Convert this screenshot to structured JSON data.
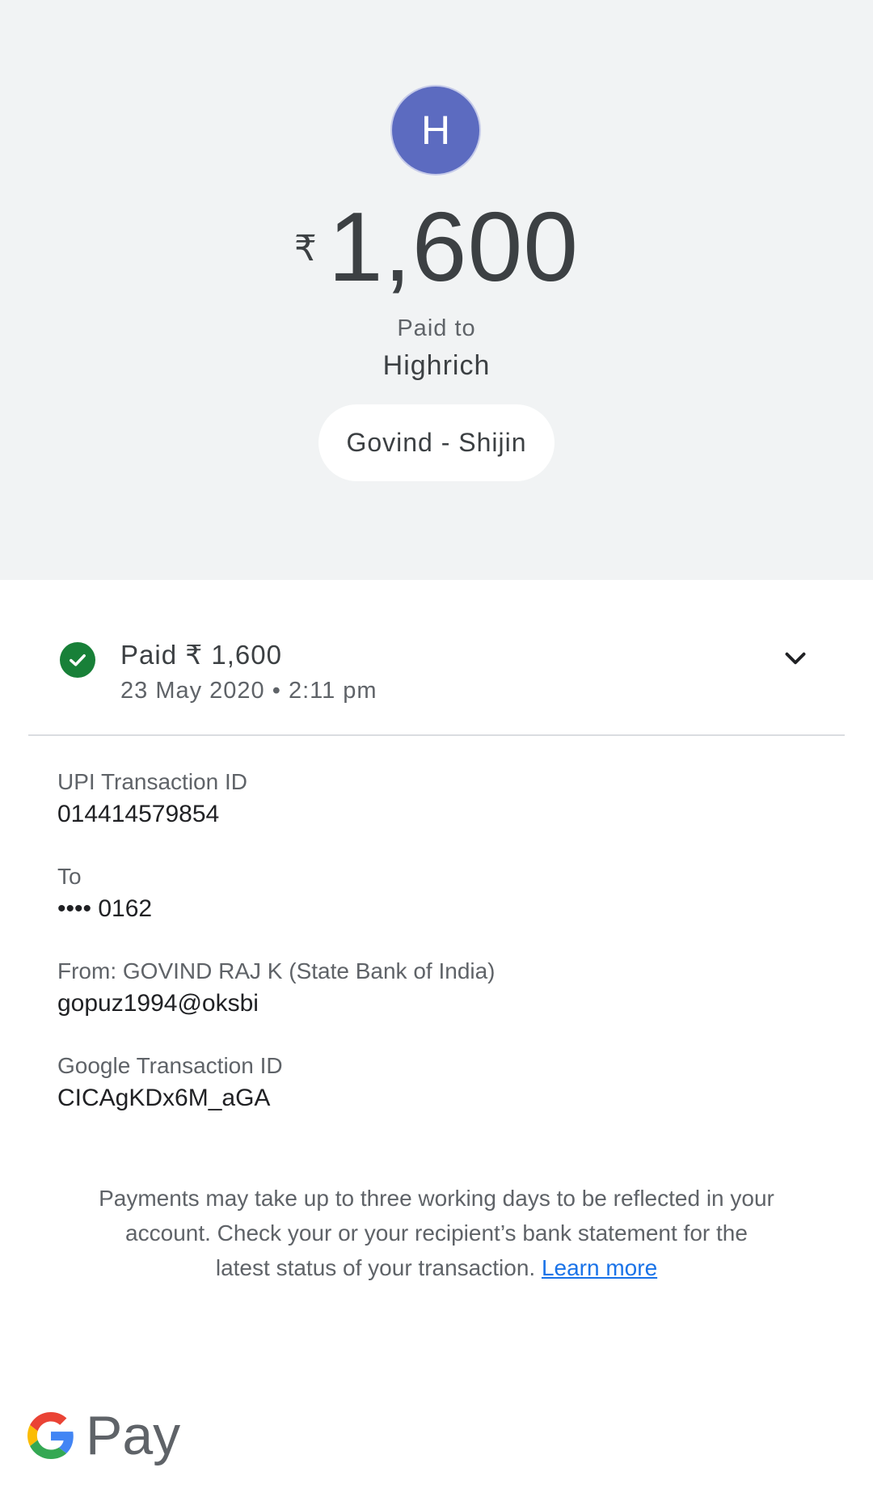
{
  "header": {
    "avatar_letter": "H",
    "currency_symbol": "₹",
    "amount": "1,600",
    "paid_to_label": "Paid to",
    "payee_name": "Highrich",
    "note": "Govind - Shijin"
  },
  "status": {
    "title": "Paid ₹ 1,600",
    "date": "23 May 2020 • 2:11 pm",
    "icon": "check-circle-icon",
    "expand_icon": "chevron-down-icon"
  },
  "details": [
    {
      "label": "UPI Transaction ID",
      "value": "014414579854"
    },
    {
      "label": "To",
      "value": "•••• 0162"
    },
    {
      "label": "From: GOVIND RAJ  K (State Bank of India)",
      "value": "gopuz1994@oksbi"
    },
    {
      "label": "Google Transaction ID",
      "value": "CICAgKDx6M_aGA"
    }
  ],
  "disclaimer": {
    "text": "Payments may take up to three working days to be reflected in your account. Check your or your recipient’s bank statement for the latest status of your transaction. ",
    "link_label": "Learn more"
  },
  "logo": {
    "brand_text": "Pay"
  },
  "colors": {
    "avatar": "#5c6bc0",
    "success": "#188038",
    "link": "#1a73e8",
    "header_bg": "#f1f3f4"
  }
}
